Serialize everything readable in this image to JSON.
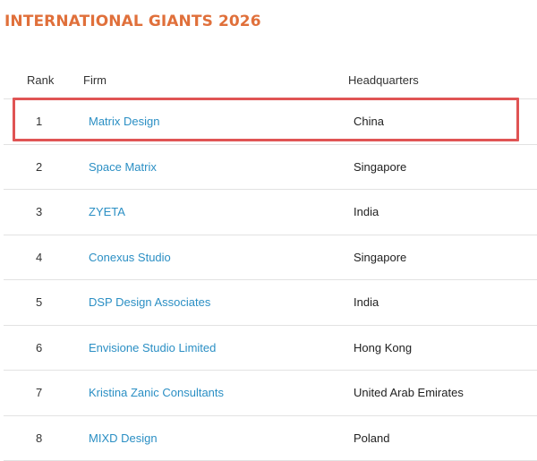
{
  "page": {
    "title": "INTERNATIONAL GIANTS 2026"
  },
  "table": {
    "headers": {
      "rank": "Rank",
      "firm": "Firm",
      "headquarters": "Headquarters"
    },
    "rows": [
      {
        "rank": "1",
        "firm": "Matrix Design",
        "headquarters": "China"
      },
      {
        "rank": "2",
        "firm": "Space Matrix",
        "headquarters": "Singapore"
      },
      {
        "rank": "3",
        "firm": "ZYETA",
        "headquarters": "India"
      },
      {
        "rank": "4",
        "firm": "Conexus Studio",
        "headquarters": "Singapore"
      },
      {
        "rank": "5",
        "firm": "DSP Design Associates",
        "headquarters": "India"
      },
      {
        "rank": "6",
        "firm": "Envisione Studio Limited",
        "headquarters": "Hong Kong"
      },
      {
        "rank": "7",
        "firm": "Kristina Zanic Consultants",
        "headquarters": "United Arab Emirates"
      },
      {
        "rank": "8",
        "firm": "MIXD Design",
        "headquarters": "Poland"
      }
    ]
  },
  "colors": {
    "title": "#e0703b",
    "link": "#2b8fc4",
    "highlight": "#e05454",
    "divider": "#e2e2e2"
  }
}
